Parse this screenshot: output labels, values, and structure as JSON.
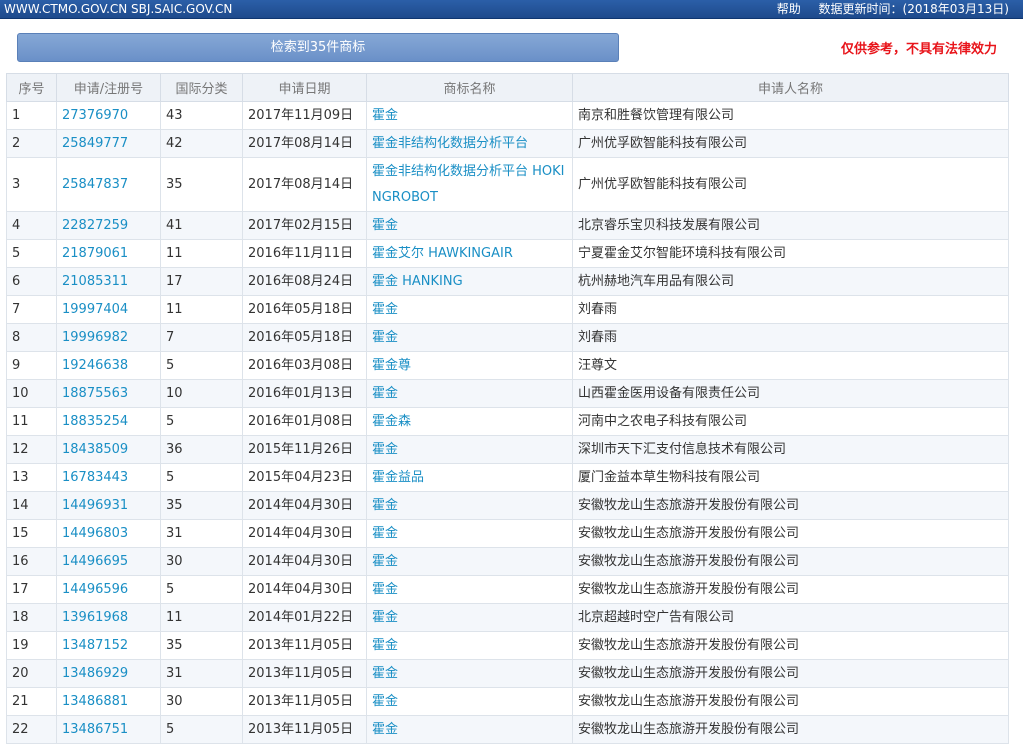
{
  "topbar": {
    "urls": "WWW.CTMO.GOV.CN  SBJ.SAIC.GOV.CN",
    "help": "帮助",
    "update_time": "数据更新时间：(2018年03月13日)"
  },
  "search": {
    "summary": "检索到35件商标",
    "disclaimer": "仅供参考，不具有法律效力"
  },
  "table": {
    "headers": [
      "序号",
      "申请/注册号",
      "国际分类",
      "申请日期",
      "商标名称",
      "申请人名称"
    ],
    "rows": [
      {
        "no": "1",
        "reg": "27376970",
        "cls": "43",
        "date": "2017年11月09日",
        "name": "霍金",
        "applicant": "南京和胜餐饮管理有限公司"
      },
      {
        "no": "2",
        "reg": "25849777",
        "cls": "42",
        "date": "2017年08月14日",
        "name": "霍金非结构化数据分析平台",
        "applicant": "广州优孚欧智能科技有限公司"
      },
      {
        "no": "3",
        "reg": "25847837",
        "cls": "35",
        "date": "2017年08月14日",
        "name": "霍金非结构化数据分析平台 HOKINGROBOT",
        "applicant": "广州优孚欧智能科技有限公司"
      },
      {
        "no": "4",
        "reg": "22827259",
        "cls": "41",
        "date": "2017年02月15日",
        "name": "霍金",
        "applicant": "北京睿乐宝贝科技发展有限公司"
      },
      {
        "no": "5",
        "reg": "21879061",
        "cls": "11",
        "date": "2016年11月11日",
        "name": "霍金艾尔 HAWKINGAIR",
        "applicant": "宁夏霍金艾尔智能环境科技有限公司"
      },
      {
        "no": "6",
        "reg": "21085311",
        "cls": "17",
        "date": "2016年08月24日",
        "name": "霍金 HANKING",
        "applicant": "杭州赫地汽车用品有限公司"
      },
      {
        "no": "7",
        "reg": "19997404",
        "cls": "11",
        "date": "2016年05月18日",
        "name": "霍金",
        "applicant": "刘春雨"
      },
      {
        "no": "8",
        "reg": "19996982",
        "cls": "7",
        "date": "2016年05月18日",
        "name": "霍金",
        "applicant": "刘春雨"
      },
      {
        "no": "9",
        "reg": "19246638",
        "cls": "5",
        "date": "2016年03月08日",
        "name": "霍金尊",
        "applicant": "汪尊文"
      },
      {
        "no": "10",
        "reg": "18875563",
        "cls": "10",
        "date": "2016年01月13日",
        "name": "霍金",
        "applicant": "山西霍金医用设备有限责任公司"
      },
      {
        "no": "11",
        "reg": "18835254",
        "cls": "5",
        "date": "2016年01月08日",
        "name": "霍金森",
        "applicant": "河南中之农电子科技有限公司"
      },
      {
        "no": "12",
        "reg": "18438509",
        "cls": "36",
        "date": "2015年11月26日",
        "name": "霍金",
        "applicant": "深圳市天下汇支付信息技术有限公司"
      },
      {
        "no": "13",
        "reg": "16783443",
        "cls": "5",
        "date": "2015年04月23日",
        "name": "霍金益品",
        "applicant": "厦门金益本草生物科技有限公司"
      },
      {
        "no": "14",
        "reg": "14496931",
        "cls": "35",
        "date": "2014年04月30日",
        "name": "霍金",
        "applicant": "安徽牧龙山生态旅游开发股份有限公司"
      },
      {
        "no": "15",
        "reg": "14496803",
        "cls": "31",
        "date": "2014年04月30日",
        "name": "霍金",
        "applicant": "安徽牧龙山生态旅游开发股份有限公司"
      },
      {
        "no": "16",
        "reg": "14496695",
        "cls": "30",
        "date": "2014年04月30日",
        "name": "霍金",
        "applicant": "安徽牧龙山生态旅游开发股份有限公司"
      },
      {
        "no": "17",
        "reg": "14496596",
        "cls": "5",
        "date": "2014年04月30日",
        "name": "霍金",
        "applicant": "安徽牧龙山生态旅游开发股份有限公司"
      },
      {
        "no": "18",
        "reg": "13961968",
        "cls": "11",
        "date": "2014年01月22日",
        "name": "霍金",
        "applicant": "北京超越时空广告有限公司"
      },
      {
        "no": "19",
        "reg": "13487152",
        "cls": "35",
        "date": "2013年11月05日",
        "name": "霍金",
        "applicant": "安徽牧龙山生态旅游开发股份有限公司"
      },
      {
        "no": "20",
        "reg": "13486929",
        "cls": "31",
        "date": "2013年11月05日",
        "name": "霍金",
        "applicant": "安徽牧龙山生态旅游开发股份有限公司"
      },
      {
        "no": "21",
        "reg": "13486881",
        "cls": "30",
        "date": "2013年11月05日",
        "name": "霍金",
        "applicant": "安徽牧龙山生态旅游开发股份有限公司"
      },
      {
        "no": "22",
        "reg": "13486751",
        "cls": "5",
        "date": "2013年11月05日",
        "name": "霍金",
        "applicant": "安徽牧龙山生态旅游开发股份有限公司"
      }
    ]
  }
}
